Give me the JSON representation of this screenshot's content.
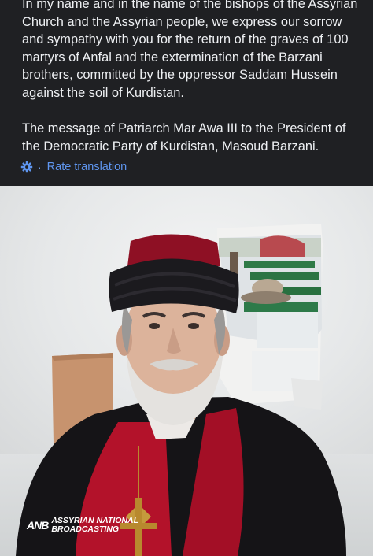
{
  "post": {
    "text": "In my name and in the name of the bishops of the Assyrian Church and the Assyrian people, we express our sorrow and sympathy with you for the return of the graves of 100 martyrs of Anfal and the extermination of the Barzani brothers, committed by the oppressor Saddam Hussein against the soil of Kurdistan.\n\nThe message of Patriarch Mar Awa III to the President of the Democratic Party of Kurdistan, Masoud Barzani.",
    "translate_icon": "gear-icon",
    "translate_separator": "·",
    "translate_label": "Rate translation"
  },
  "image": {
    "watermark_line1": "ASSYRIAN NATIONAL",
    "watermark_line2": "BROADCASTING",
    "watermark_logo": "ANB"
  },
  "colors": {
    "background": "#1f2023",
    "text": "#eef0f3",
    "link": "#5f96f0",
    "robe_red": "#b3122a",
    "hat_black": "#1b1a1e"
  }
}
